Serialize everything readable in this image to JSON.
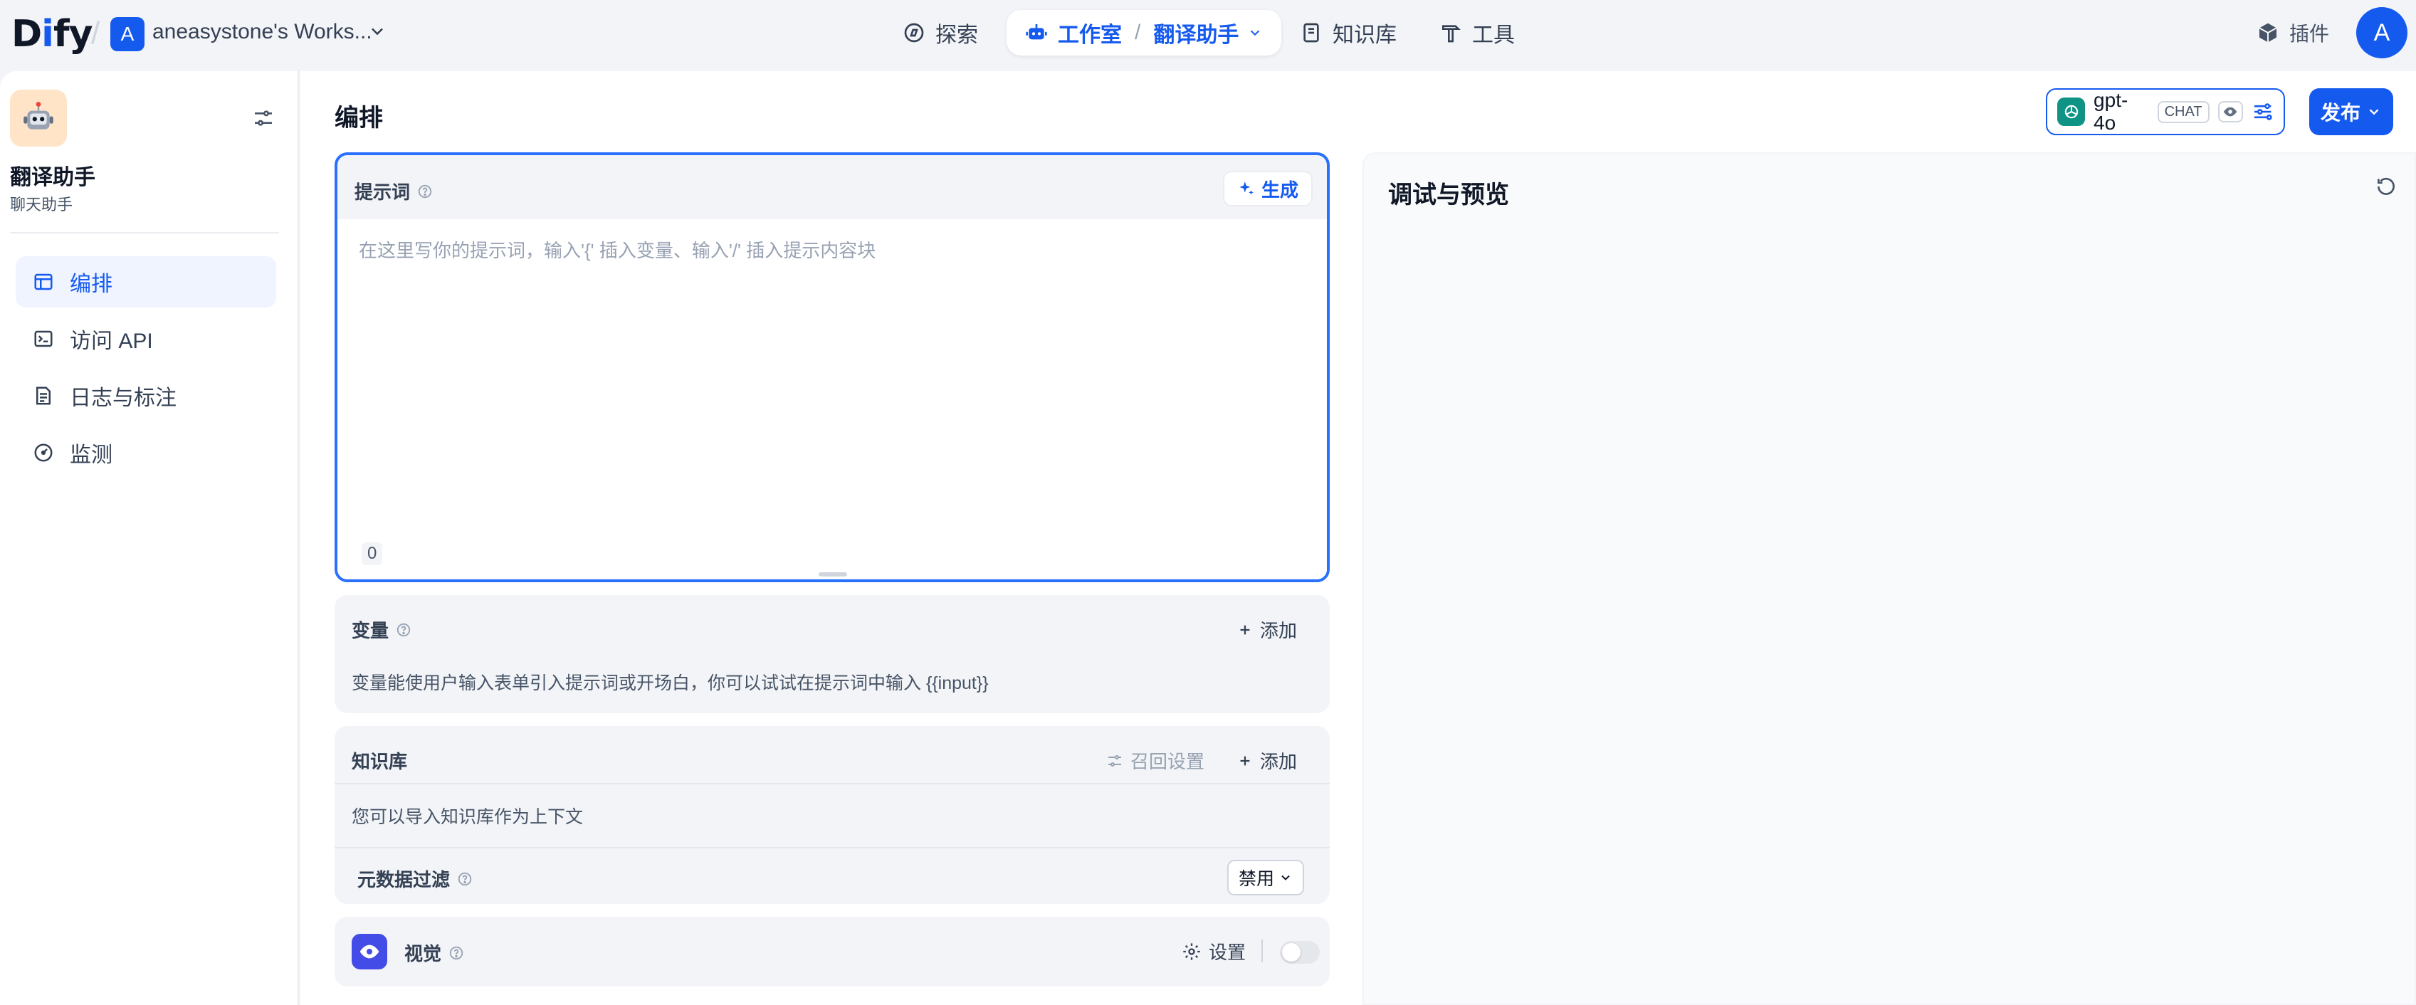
{
  "header": {
    "logo_d": "D",
    "logo_i": "i",
    "logo_fy": "fy",
    "workspace_initial": "A",
    "workspace_name": "aneasystone's Works...",
    "nav": {
      "explore": "探索",
      "studio": "工作室",
      "current_app": "翻译助手",
      "knowledge": "知识库",
      "tools": "工具"
    },
    "plugins": "插件",
    "user_initial": "A"
  },
  "sidebar": {
    "app_name": "翻译助手",
    "app_type": "聊天助手",
    "items": [
      {
        "label": "编排",
        "icon": "layout-icon",
        "active": true
      },
      {
        "label": "访问 API",
        "icon": "terminal-icon",
        "active": false
      },
      {
        "label": "日志与标注",
        "icon": "file-list-icon",
        "active": false
      },
      {
        "label": "监测",
        "icon": "dashboard-icon",
        "active": false
      }
    ]
  },
  "main": {
    "title": "编排",
    "model": {
      "name": "gpt-4o",
      "mode_badge": "CHAT"
    },
    "publish_label": "发布",
    "prompt": {
      "label": "提示词",
      "generate_label": "生成",
      "placeholder": "在这里写你的提示词，输入'{' 插入变量、输入'/' 插入提示内容块",
      "value": "",
      "char_count": "0"
    },
    "variables": {
      "title": "变量",
      "add_label": "添加",
      "description": "变量能使用户输入表单引入提示词或开场白，你可以试试在提示词中输入 {{input}}"
    },
    "knowledge": {
      "title": "知识库",
      "recall_label": "召回设置",
      "add_label": "添加",
      "description": "您可以导入知识库作为上下文",
      "metadata_filter_label": "元数据过滤",
      "metadata_filter_value": "禁用"
    },
    "vision": {
      "title": "视觉",
      "settings_label": "设置",
      "enabled": false
    }
  },
  "debug": {
    "title": "调试与预览"
  },
  "colors": {
    "primary": "#155aef",
    "app_icon_bg": "#ffe4c7",
    "vision_icon_bg": "#444ce7",
    "model_logo_bg": "#0e9384"
  }
}
